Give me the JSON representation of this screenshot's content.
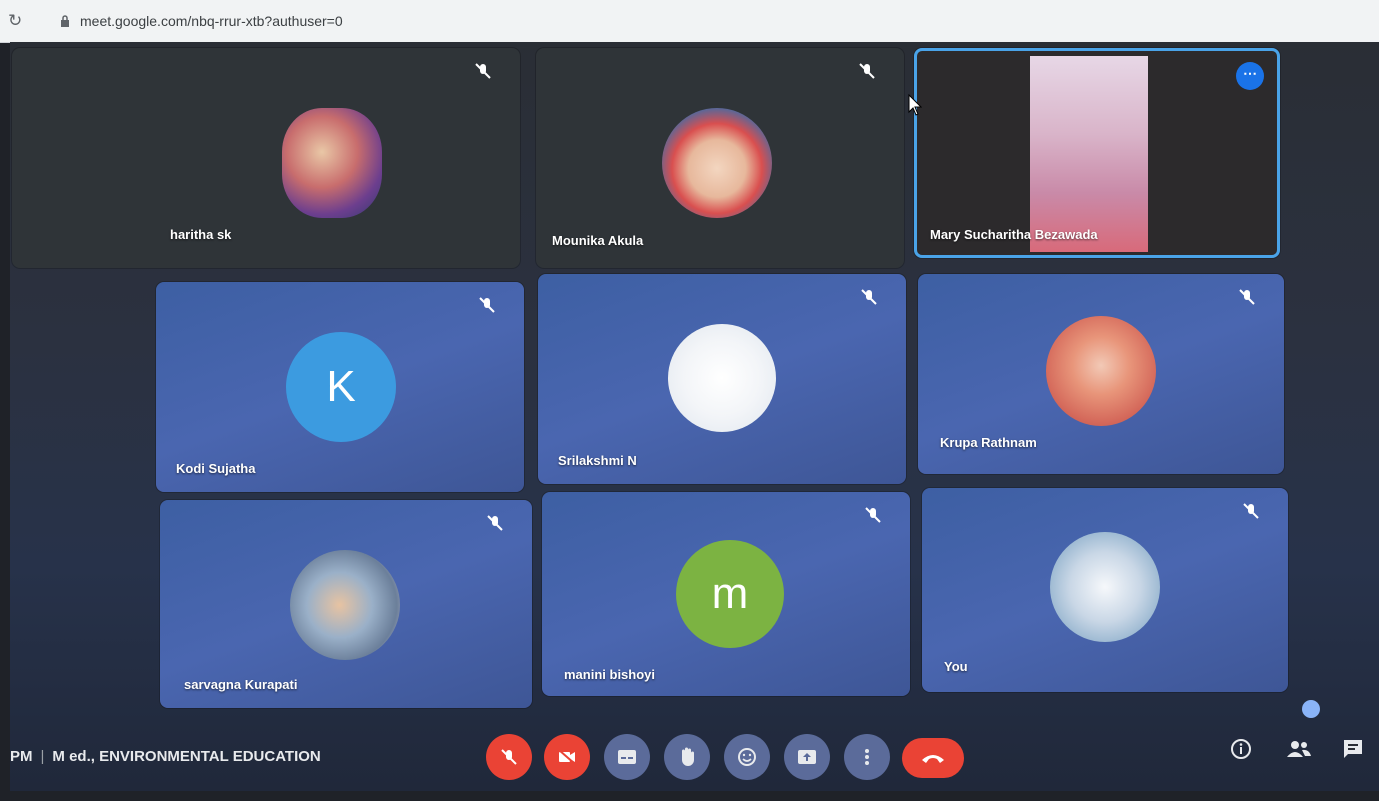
{
  "browser": {
    "url": "meet.google.com/nbq-rrur-xtb?authuser=0"
  },
  "tiles": [
    {
      "name": "haritha sk",
      "avatar": "photo"
    },
    {
      "name": "Mounika Akula",
      "avatar": "photo"
    },
    {
      "name": "Mary Sucharitha Bezawada",
      "avatar": "video"
    },
    {
      "name": "Kodi Sujatha",
      "avatar_letter": "K",
      "avatar_color": "#3c9be0"
    },
    {
      "name": "Srilakshmi N",
      "avatar": "photo"
    },
    {
      "name": "Krupa Rathnam",
      "avatar": "photo"
    },
    {
      "name": "sarvagna Kurapati",
      "avatar": "photo"
    },
    {
      "name": "manini bishoyi",
      "avatar_letter": "m",
      "avatar_color": "#7cb342"
    },
    {
      "name": "You",
      "avatar": "photo"
    }
  ],
  "meeting": {
    "time_suffix": "PM",
    "separator": "|",
    "title": "M ed., ENVIRONMENTAL EDUCATION"
  },
  "controls": {
    "icons": [
      "mic-off-icon",
      "camera-off-icon",
      "captions-icon",
      "raise-hand-icon",
      "emoji-icon",
      "present-icon",
      "more-options-icon",
      "end-call-icon"
    ]
  },
  "colors": {
    "active_border": "#4aa3e8",
    "danger": "#ea4335",
    "tile_blue": "#4a66b0"
  }
}
